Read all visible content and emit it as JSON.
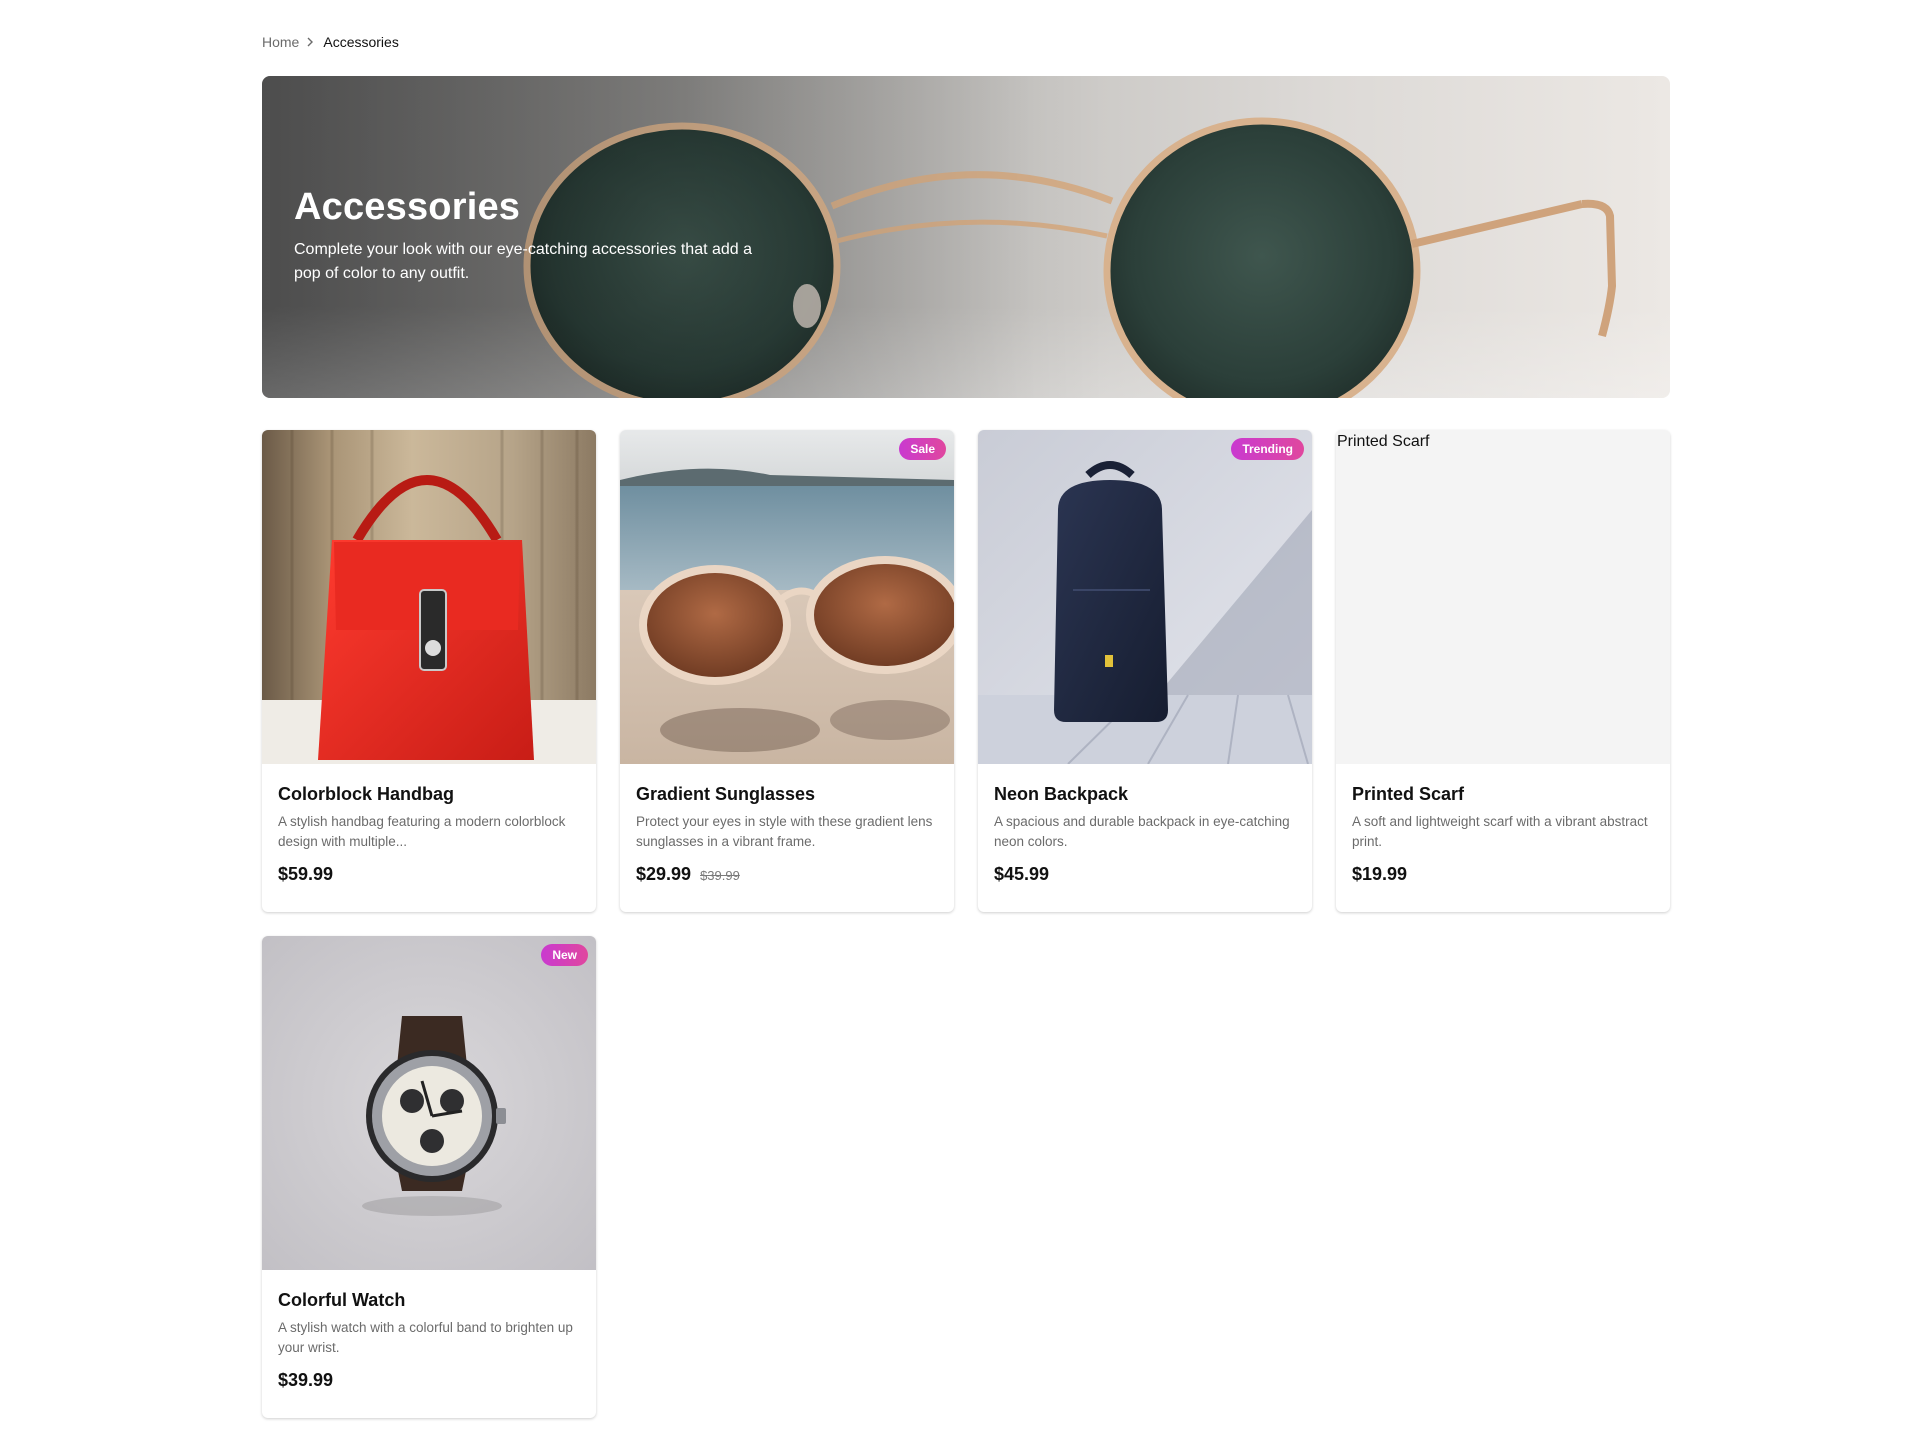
{
  "breadcrumb": {
    "home": "Home",
    "current": "Accessories"
  },
  "hero": {
    "title": "Accessories",
    "description": "Complete your look with our eye-catching accessories that add a pop of color to any outfit.",
    "image": "sunglasses-photo"
  },
  "products": [
    {
      "title": "Colorblock Handbag",
      "description": "A stylish handbag featuring a modern colorblock design with multiple...",
      "price": "$59.99",
      "badge": "",
      "old_price": "",
      "image": "red-handbag-photo"
    },
    {
      "title": "Gradient Sunglasses",
      "description": "Protect your eyes in style with these gradient lens sunglasses in a vibrant frame.",
      "price": "$29.99",
      "old_price": "$39.99",
      "badge": "Sale",
      "image": "sunglasses-on-beach-photo"
    },
    {
      "title": "Neon Backpack",
      "description": "A spacious and durable backpack in eye-catching neon colors.",
      "price": "$45.99",
      "badge": "Trending",
      "old_price": "",
      "image": "navy-backpack-photo"
    },
    {
      "title": "Printed Scarf",
      "description": "A soft and lightweight scarf with a vibrant abstract print.",
      "price": "$19.99",
      "badge": "",
      "old_price": "",
      "image_alt": "Printed Scarf",
      "image": "broken-image"
    },
    {
      "title": "Colorful Watch",
      "description": "A stylish watch with a colorful band to brighten up your wrist.",
      "price": "$39.99",
      "badge": "New",
      "old_price": "",
      "image": "chronograph-watch-photo"
    }
  ],
  "colors": {
    "badge_start": "#c93ad0",
    "badge_end": "#e0479e",
    "text": "#111111",
    "muted": "#6b6b6b"
  }
}
